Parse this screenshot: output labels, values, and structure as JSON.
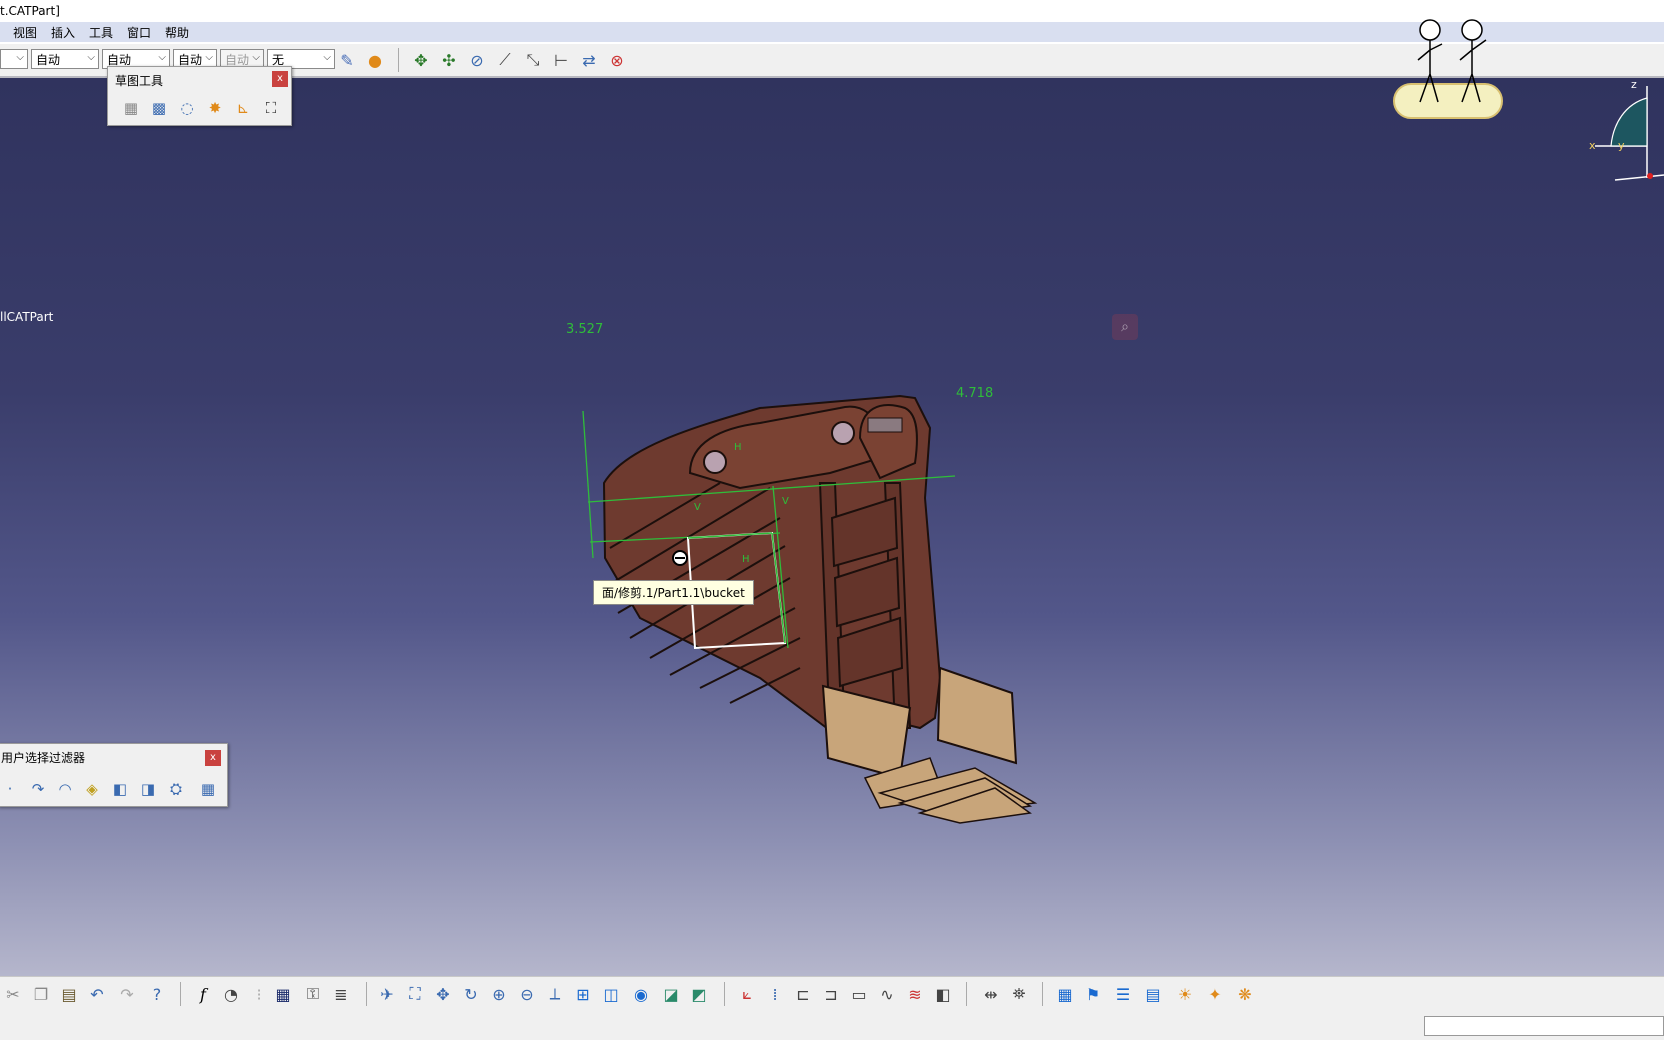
{
  "window": {
    "title": "t.CATPart]"
  },
  "menu": [
    "视图",
    "插入",
    "工具",
    "窗口",
    "帮助"
  ],
  "top_toolbar": {
    "combos": [
      {
        "value": "",
        "disabled": false
      },
      {
        "value": "自动",
        "disabled": false
      },
      {
        "value": "自动",
        "disabled": false
      },
      {
        "value": "自动",
        "disabled": false
      },
      {
        "value": "自动",
        "disabled": true
      },
      {
        "value": "无",
        "disabled": false
      }
    ]
  },
  "sketch_tools_panel": {
    "title": "草图工具",
    "close": "x"
  },
  "filter_panel": {
    "title": "用户选择过滤器",
    "close": "x"
  },
  "viewport": {
    "tree_label": "llCATPart",
    "dimension_vertical": "3.527",
    "dimension_horizontal": "4.718",
    "tooltip": "面/修剪.1/Part1.1\\bucket",
    "constraint_h_top": "H",
    "constraint_h_bottom": "H",
    "constraint_v_left": "V",
    "constraint_v_right": "V",
    "compass_x": "x",
    "compass_y": "y",
    "compass_z": "z"
  },
  "colors": {
    "viewport_top": "#30335e",
    "viewport_bottom": "#b5b6cc",
    "bucket_body": "#6e3a2f",
    "bucket_tooth": "#c8a57a",
    "dimension_green": "#2fbd3a",
    "close_red": "#c9423f"
  },
  "icons": {
    "top_toolbar": [
      "paint-brush-icon",
      "material-apply-icon",
      "pan-icon",
      "rotate-icon",
      "no-show-icon",
      "measure-icon",
      "normal-view-icon",
      "constraint-icon",
      "swap-icon",
      "hide-show-icon"
    ],
    "sketch_tools": [
      "grid-icon",
      "snap-to-point-icon",
      "construction-icon",
      "geometric-constraint-icon",
      "dimension-constraint-icon",
      "auto-constraint-icon"
    ],
    "filter": [
      "point-filter-icon",
      "curve-filter-icon",
      "surface-filter-icon",
      "volume-filter-icon",
      "feature-filter-icon",
      "geometry-filter-icon",
      "quick-select-icon",
      "intersection-icon"
    ],
    "bottom_toolbar": [
      "cut-icon",
      "copy-icon",
      "paste-icon",
      "undo-icon",
      "redo-icon",
      "whats-this-icon",
      "formula-icon",
      "comment-icon",
      "table-icon",
      "lock-icon",
      "knowledge-icon",
      "fly-icon",
      "fit-all-icon",
      "pan-icon",
      "rotate-icon",
      "zoom-in-icon",
      "zoom-out-icon",
      "normal-view-icon",
      "multi-view-icon",
      "iso-view-icon",
      "shading-icon",
      "hide-icon",
      "swap-icon",
      "axis-icon",
      "parallel-icon",
      "sketch-icon",
      "sketch-positioned-icon",
      "profile-icon",
      "rectangle-icon",
      "spline-icon",
      "constraint-icon",
      "cut-part-icon",
      "project-icon",
      "grid-icon",
      "snap-icon",
      "layer-icon",
      "section-icon",
      "sun-icon",
      "light-icon",
      "render-icon"
    ]
  }
}
